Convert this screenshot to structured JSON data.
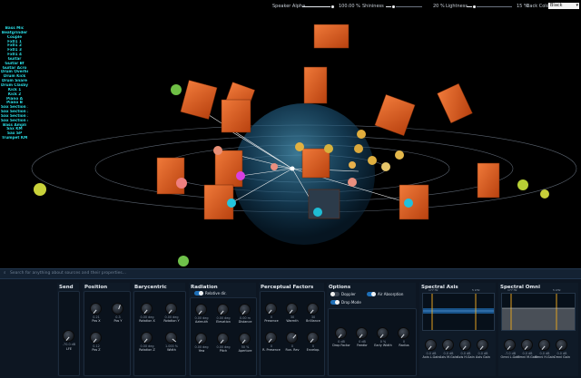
{
  "toolbar": {
    "speaker_alpha_label": "Speaker Alpha",
    "speaker_alpha_value": "100.00 %",
    "speaker_alpha_fraction": 1.0,
    "shininess_label": "Shininess",
    "shininess_value": "20 %",
    "shininess_fraction": 0.2,
    "lightness_label": "Lightness",
    "lightness_value": "15 %",
    "lightness_fraction": 0.15,
    "back_color_label": "Back Color",
    "back_color_value": "Black"
  },
  "sources": [
    "Bass Mic",
    "Beatgrinder",
    "Couple",
    "Fx01 1",
    "Fx01 2",
    "Fx01 3",
    "Fx01 4",
    "Guitar",
    "Guitar Bf",
    "Guitar Acro",
    "Drum Overhead",
    "Drum Kick",
    "Drum Snare",
    "Drum Clasby",
    "Kick 1",
    "Kick 2",
    "Piano A",
    "Piano B",
    "Sax Section 1",
    "Sax Section 2",
    "Sax Section 3",
    "Sax Section 4",
    "Bass Ampli",
    "Sax KM",
    "Sax SP",
    "Trumpet KM"
  ],
  "search": {
    "placeholder": "Search for anything about sources and their properties..."
  },
  "panels": {
    "send": {
      "title": "Send",
      "value": "-70.0 dB",
      "label": "LFE"
    },
    "position": {
      "title": "Position",
      "knobs": [
        {
          "value": "0.21",
          "label": "Pos X"
        },
        {
          "value": "0.3",
          "label": "Pos Y"
        },
        {
          "value": "0.12",
          "label": "Pos Z"
        }
      ]
    },
    "barycentric": {
      "title": "Barycentric",
      "knobs": [
        {
          "value": "0.00 deg",
          "label": "Rotation X"
        },
        {
          "value": "0.00 deg",
          "label": "Rotation Y"
        },
        {
          "value": "0.00 deg",
          "label": "Rotation Z"
        },
        {
          "value": "1.000 %",
          "label": "Width"
        }
      ]
    },
    "radiation": {
      "title": "Radiation",
      "toggle_label": "Relative dir.",
      "toggle_on": true,
      "knobs": [
        {
          "value": "0.00 deg",
          "label": "Azimuth"
        },
        {
          "value": "0.00 deg",
          "label": "Elevation"
        },
        {
          "value": "0.00 m",
          "label": "Distance"
        },
        {
          "value": "0.00 deg",
          "label": "Yaw"
        },
        {
          "value": "0.00 deg",
          "label": "Pitch"
        },
        {
          "value": "50 %",
          "label": "Aperture"
        }
      ]
    },
    "perceptual": {
      "title": "Perceptual Factors",
      "knobs": [
        {
          "value": "0",
          "label": "Presence"
        },
        {
          "value": "30",
          "label": "Warmth"
        },
        {
          "value": "30",
          "label": "Brilliance"
        },
        {
          "value": "0",
          "label": "R. Presence"
        },
        {
          "value": "0",
          "label": "Run. Rev"
        },
        {
          "value": "0",
          "label": "Envelop."
        }
      ]
    },
    "options": {
      "title": "Options",
      "toggles": [
        {
          "label": "Doppler",
          "on": false
        },
        {
          "label": "Air Absorption",
          "on": true
        },
        {
          "label": "Drop Mode",
          "on": true
        }
      ],
      "knobs": [
        {
          "value": "0 dB",
          "label": "Drop Factor"
        },
        {
          "value": "0 dB",
          "label": "Feedbr"
        },
        {
          "value": "0 %",
          "label": "Early Width"
        },
        {
          "value": "0",
          "label": "Radius"
        }
      ]
    },
    "spectral_axis": {
      "title": "Spectral Axis",
      "band_label": "177 Hz",
      "band_label_2": "5 kHz",
      "knobs": [
        {
          "value": "0.0 dB",
          "label": "Axis L.Gain"
        },
        {
          "value": "0.0 dB",
          "label": "Axis M.Gain"
        },
        {
          "value": "0.0 dB",
          "label": "Axis H.Gain"
        },
        {
          "value": "0.0 dB",
          "label": "Axis Gain"
        }
      ]
    },
    "spectral_omni": {
      "title": "Spectral Omni",
      "band_label": "177 Hz",
      "band_label_2": "5 kHz",
      "knobs": [
        {
          "value": "-7.0 dB",
          "label": "Omni L.Gain"
        },
        {
          "value": "0.0 dB",
          "label": "Omni M.Gain"
        },
        {
          "value": "0.0 dB",
          "label": "Omni H.Gain"
        },
        {
          "value": "0.0 dB",
          "label": "Omni Gain"
        }
      ]
    }
  },
  "colors": {
    "speaker": "#d9541d",
    "sphere": "#2a6c93",
    "accent": "#1e6fb8",
    "list_text": "#2ad8e0"
  }
}
